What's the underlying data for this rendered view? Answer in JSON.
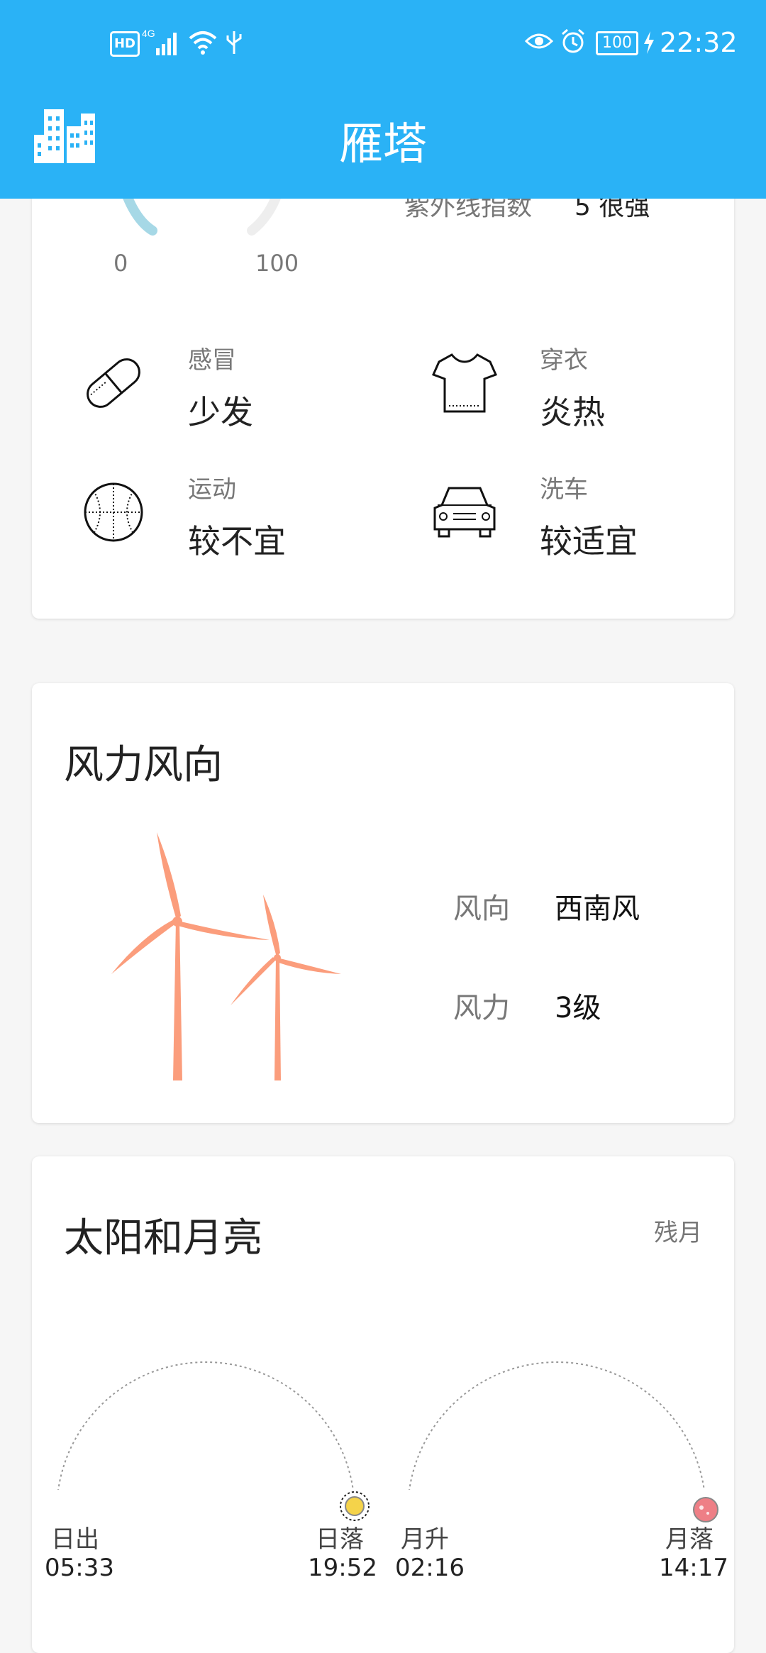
{
  "status_bar": {
    "time": "22:32",
    "left_icons": "HD 4G",
    "battery": "100"
  },
  "header": {
    "title": "雁塔",
    "icon": "city-buildings-icon"
  },
  "aqi": {
    "min": "0",
    "max": "100",
    "uv_label": "紫外线指数",
    "uv_value": "5 很强"
  },
  "life": {
    "items": [
      {
        "label": "感冒",
        "value": "少发",
        "icon": "pill-icon"
      },
      {
        "label": "穿衣",
        "value": "炎热",
        "icon": "tshirt-icon"
      },
      {
        "label": "运动",
        "value": "较不宜",
        "icon": "basketball-icon"
      },
      {
        "label": "洗车",
        "value": "较适宜",
        "icon": "car-icon"
      }
    ]
  },
  "wind": {
    "title": "风力风向",
    "direction_label": "风向",
    "direction_value": "西南风",
    "force_label": "风力",
    "force_value": "3级"
  },
  "sunmoon": {
    "title": "太阳和月亮",
    "moon_phase": "残月",
    "sunrise_label": "日出",
    "sunrise_time": "05:33",
    "sunset_label": "日落",
    "sunset_time": "19:52",
    "moonrise_label": "月升",
    "moonrise_time": "02:16",
    "moonset_label": "月落",
    "moonset_time": "14:17"
  },
  "colors": {
    "header": "#2ab2f6",
    "turbine": "#fb9d7c",
    "sun": "#f5d34a",
    "moon": "#ee7f86"
  }
}
